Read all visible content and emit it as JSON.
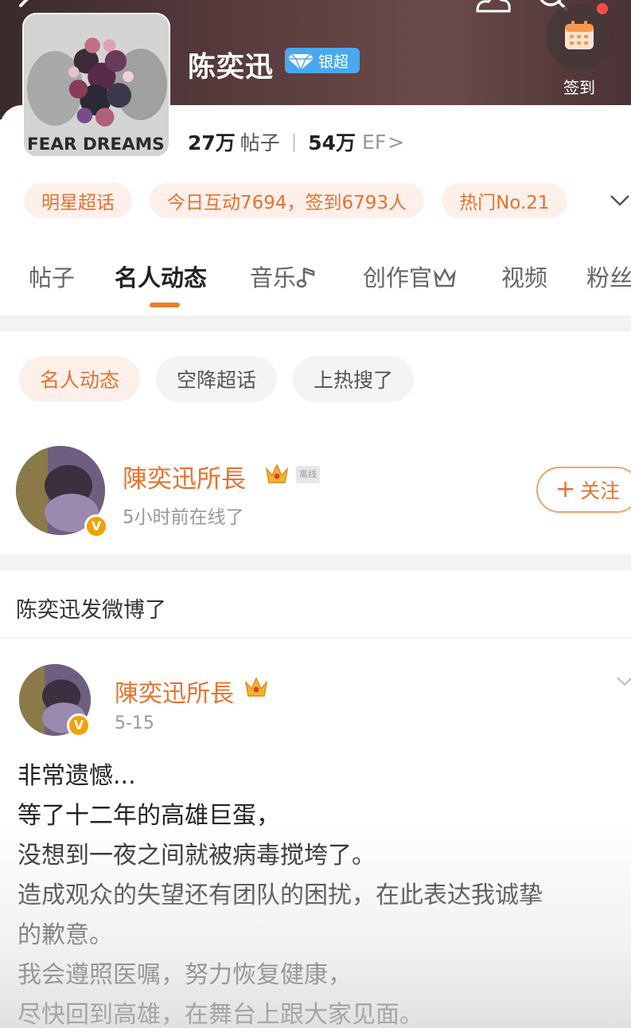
{
  "header": {
    "checkin_label": "签到",
    "title": "陈奕迅",
    "badge_label": "银超",
    "cover_text": "FEAR DREAMS"
  },
  "stats": {
    "posts_value": "27万",
    "posts_unit": "帖子",
    "ef_value": "54万",
    "ef_unit": "EF",
    "ef_arrow": ">"
  },
  "chips": [
    {
      "label": "明星超话"
    },
    {
      "label": "今日互动7694，签到6793人"
    },
    {
      "label": "热门No.21"
    }
  ],
  "tabs": [
    {
      "label": "帖子"
    },
    {
      "label": "名人动态"
    },
    {
      "label": "音乐"
    },
    {
      "label": "创作官"
    },
    {
      "label": "视频"
    },
    {
      "label": "粉丝"
    }
  ],
  "filters": [
    {
      "label": "名人动态"
    },
    {
      "label": "空降超话"
    },
    {
      "label": "上热搜了"
    }
  ],
  "celebrity": {
    "name": "陳奕迅所長",
    "offline_tag": "离线",
    "status": "5小时前在线了",
    "follow_label": "关注",
    "follow_plus": "+"
  },
  "section_title": "陈奕迅发微博了",
  "post": {
    "author": "陳奕迅所長",
    "date": "5-15",
    "lines": [
      "非常遗憾...",
      "等了十二年的高雄巨蛋，",
      "没想到一夜之间就被病毒搅垮了。",
      "造成观众的失望还有团队的困扰，在此表达我诚挚",
      "的歉意。",
      "我会遵照医嘱，努力恢复健康，",
      "尽快回到高雄，在舞台上跟大家见面。"
    ]
  },
  "colors": {
    "accent": "#e8722f",
    "chip_bg": "#fdf0ea",
    "badge_blue": "#4aa8ee",
    "v_badge": "#f2a100"
  }
}
